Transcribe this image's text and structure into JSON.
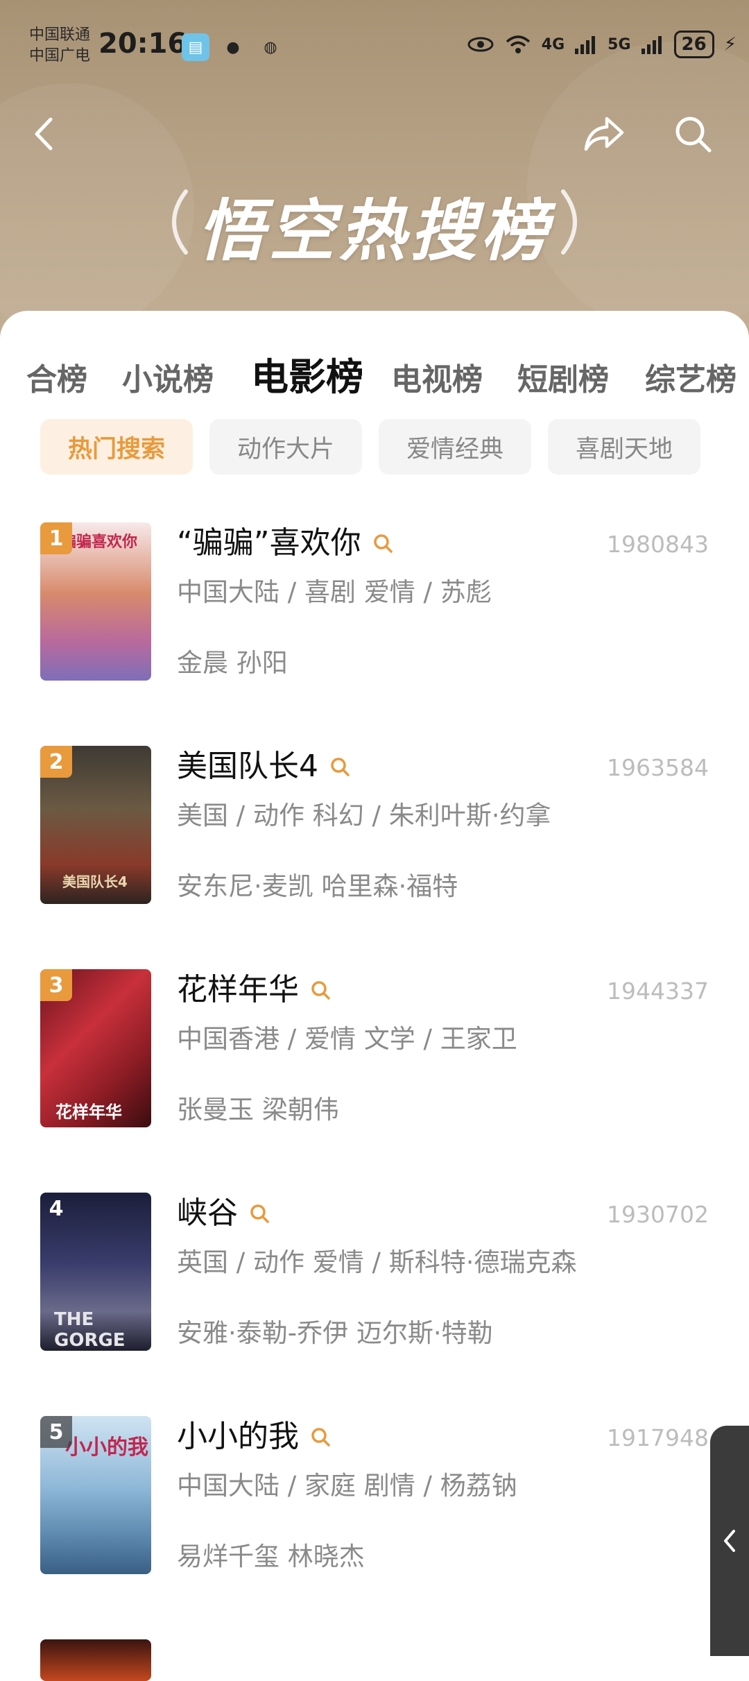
{
  "status": {
    "carrier_line1": "中国联通",
    "carrier_line2": "中国广电",
    "time": "20:16",
    "network1": "4G",
    "network2": "5G",
    "battery": "26"
  },
  "banner": {
    "title": "悟空热搜榜"
  },
  "tabs": [
    {
      "label": "合榜"
    },
    {
      "label": "小说榜"
    },
    {
      "label": "电影榜"
    },
    {
      "label": "电视榜"
    },
    {
      "label": "短剧榜"
    },
    {
      "label": "综艺榜"
    }
  ],
  "chips": [
    {
      "label": "热门搜索"
    },
    {
      "label": "动作大片"
    },
    {
      "label": "爱情经典"
    },
    {
      "label": "喜剧天地"
    }
  ],
  "items": [
    {
      "rank": "1",
      "title": "“骗骗”喜欢你",
      "hits": "1980843",
      "meta": "中国大陆 / 喜剧 爱情 / 苏彪",
      "cast": "金晨 孙阳",
      "poster_text": "骗骗喜欢你"
    },
    {
      "rank": "2",
      "title": "美国队长4",
      "hits": "1963584",
      "meta": "美国 / 动作 科幻 / 朱利叶斯·约拿",
      "cast": "安东尼·麦凯 哈里森·福特",
      "poster_text": "美国队长4"
    },
    {
      "rank": "3",
      "title": "花样年华",
      "hits": "1944337",
      "meta": "中国香港 / 爱情 文学 / 王家卫",
      "cast": "张曼玉 梁朝伟",
      "poster_text": "花样年华"
    },
    {
      "rank": "4",
      "title": "峡谷",
      "hits": "1930702",
      "meta": "英国 / 动作 爱情 / 斯科特·德瑞克森",
      "cast": "安雅·泰勒-乔伊 迈尔斯·特勒",
      "poster_text": "THE GORGE"
    },
    {
      "rank": "5",
      "title": "小小的我",
      "hits": "1917948",
      "meta": "中国大陆 / 家庭 剧情 / 杨荔钠",
      "cast": "易烊千玺 林晓杰",
      "poster_text": "小小的我"
    }
  ],
  "colors": {
    "accent": "#e89a3c",
    "header_bg": "#b5a084"
  },
  "icons": {
    "back": "chevron-left-icon",
    "share": "share-icon",
    "search": "search-icon",
    "item_search": "search-icon"
  }
}
